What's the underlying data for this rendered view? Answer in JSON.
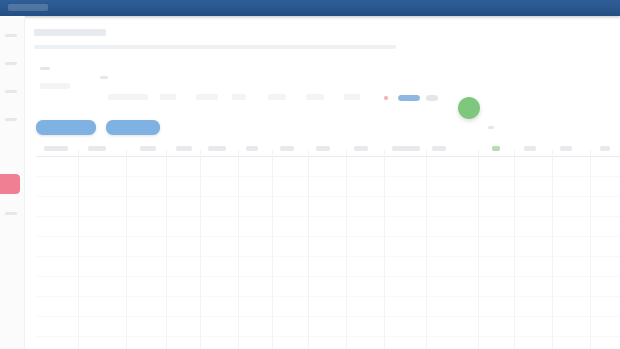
{
  "colors": {
    "topbar": "#2f5f97",
    "primary_button": "#7fb1e3",
    "fab": "#7fc77d",
    "sidebar_alert": "#f07f93"
  },
  "header": {},
  "main": {
    "title": "",
    "description": "",
    "filters": [
      {
        "label": ""
      },
      {
        "label": ""
      },
      {
        "label": ""
      },
      {
        "label": ""
      },
      {
        "label": ""
      },
      {
        "label": ""
      },
      {
        "label": ""
      },
      {
        "label": ""
      },
      {
        "label": ""
      }
    ],
    "buttons": [
      {
        "label": ""
      },
      {
        "label": ""
      }
    ]
  },
  "table": {
    "columns": [
      {
        "label": ""
      },
      {
        "label": ""
      },
      {
        "label": ""
      },
      {
        "label": ""
      },
      {
        "label": ""
      },
      {
        "label": ""
      },
      {
        "label": ""
      },
      {
        "label": ""
      },
      {
        "label": ""
      },
      {
        "label": ""
      },
      {
        "label": ""
      },
      {
        "label": ""
      },
      {
        "label": ""
      },
      {
        "label": ""
      },
      {
        "label": ""
      }
    ]
  }
}
